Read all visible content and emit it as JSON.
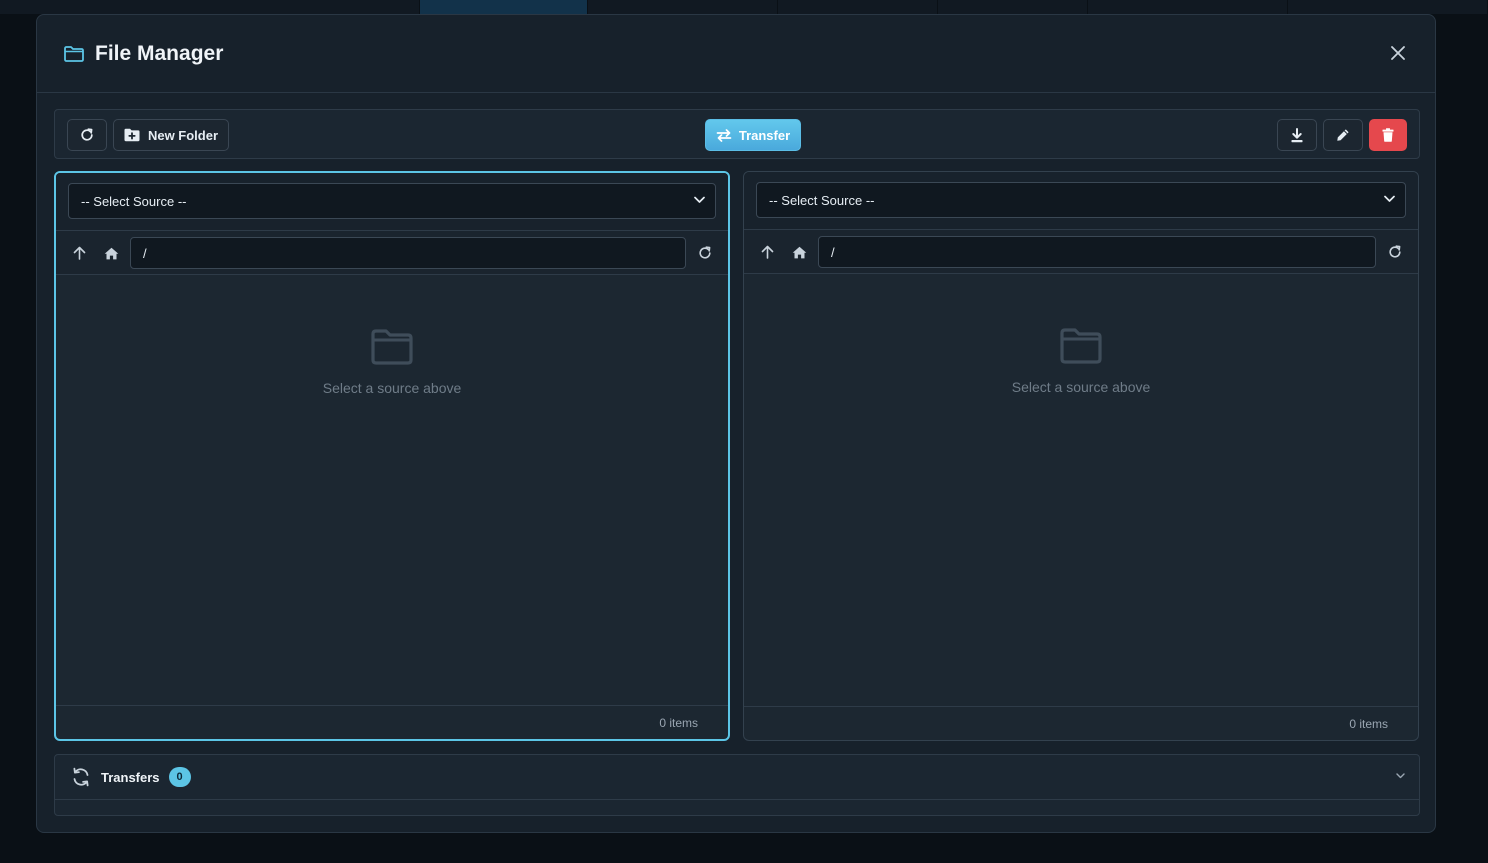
{
  "modal": {
    "title": "File Manager"
  },
  "toolbar": {
    "new_folder_label": "New Folder",
    "transfer_label": "Transfer"
  },
  "panes": {
    "left": {
      "source_select": "-- Select Source --",
      "path": "/",
      "empty_text": "Select a source above",
      "item_count": "0 items"
    },
    "right": {
      "source_select": "-- Select Source --",
      "path": "/",
      "empty_text": "Select a source above",
      "item_count": "0 items"
    }
  },
  "transfers": {
    "label": "Transfers",
    "count": "0"
  },
  "colors": {
    "accent": "#5cc5e6",
    "danger": "#e5484d",
    "background": "#17212b"
  }
}
